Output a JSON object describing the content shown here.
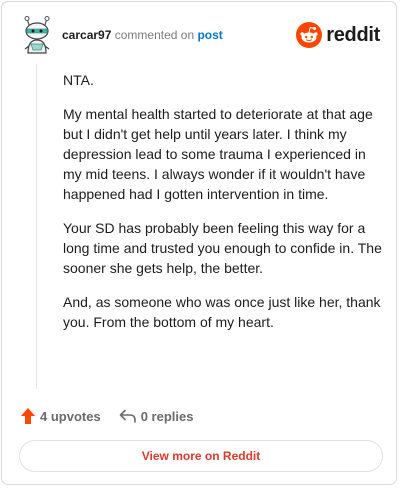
{
  "header": {
    "username": "carcar97",
    "action_text": "commented on",
    "post_link": "post",
    "brand_name": "reddit",
    "brand_color": "#ff4500"
  },
  "comment": {
    "paragraphs": [
      "NTA.",
      "My mental health started to deteriorate at that age but I didn't get help until years later. I think my depression lead to some trauma I experienced in my mid teens. I always wonder if it wouldn't have happened had I gotten intervention in time.",
      "Your SD has probably been feeling this way for a long time and trusted you enough to confide in. The sooner she gets help, the better.",
      "And, as someone who was once just like her, thank you. From the bottom of my heart."
    ]
  },
  "actions": {
    "upvotes": "4 upvotes",
    "upvote_icon": "upvote-arrow-icon",
    "upvote_color": "#ff4500",
    "replies": "0 replies",
    "reply_icon": "reply-arrow-icon"
  },
  "footer": {
    "view_more": "View more on Reddit",
    "link_color": "#e0382b"
  }
}
